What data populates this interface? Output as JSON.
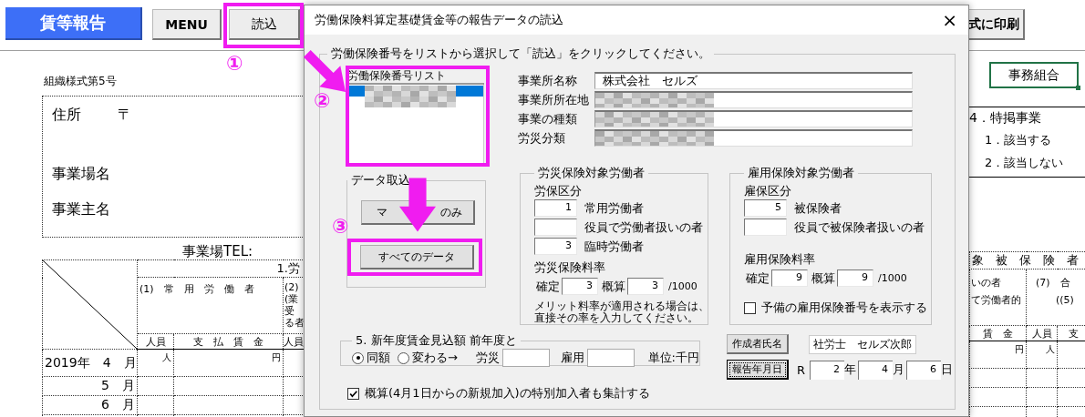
{
  "toolbar": {
    "title_button": {
      "label": "賃等報告"
    },
    "buttons": [
      {
        "label": "MENU"
      },
      {
        "label": "読込"
      }
    ],
    "print_button": {
      "label": "式に印刷"
    }
  },
  "sheet_left": {
    "form_number": "組織様式第5号",
    "address_label": "住所",
    "postal_mark": "〒",
    "site_label": "事業場名",
    "owner_label": "事業主名",
    "tel_label": "事業場TEL:",
    "table": {
      "section": "1.労",
      "col1_heading": "(1)　常　用　労　働　者",
      "col2_lines": [
        "(2)",
        "(業",
        "受",
        "る者"
      ],
      "subheads": [
        "人員",
        "支　払　賃　金",
        "人員"
      ],
      "units": [
        "人",
        "円"
      ],
      "rows": [
        "2019年　4　月",
        "5　月",
        "6　月"
      ]
    }
  },
  "sheet_right": {
    "selected_cell": "事務組合",
    "special_title": "4．特掲事業",
    "special_options": [
      "1．該当する",
      "2．該当しない"
    ],
    "table": {
      "header": "象　被　保　険　者",
      "col1_lines": [
        "いの者",
        "て労働者的"
      ],
      "col2_lines": [
        "(7)　合",
        "((5)"
      ],
      "subheads": [
        "賃　金",
        "人員",
        "支"
      ],
      "units": [
        "円",
        "人"
      ]
    }
  },
  "dialog": {
    "title": "労働保険料算定基礎賃金等の報告データの読込",
    "close": "×",
    "legend": "労働保険番号をリストから選択して「読込」をクリックしてください。",
    "list": {
      "header": "労働保険番号リスト",
      "items": [
        {
          "blurred": true,
          "selected": true
        },
        {
          "blurred": true,
          "selected": false
        }
      ]
    },
    "info": [
      {
        "label": "事業所名称",
        "value": "株式会社　セルズ"
      },
      {
        "label": "事業所所在地",
        "blurred": true
      },
      {
        "label": "事業の種類",
        "blurred": true
      },
      {
        "label": "労災分類",
        "blurred": true
      }
    ],
    "import": {
      "legend": "データ取込",
      "master_button": [
        "マ",
        "のみ"
      ],
      "all_button": "すべてのデータ"
    },
    "rousai": {
      "legend": "労災保険対象労働者",
      "class_label": "労保区分",
      "rows": [
        {
          "value": "1",
          "label": "常用労働者"
        },
        {
          "label": "役員で労働者扱いの者"
        },
        {
          "value": "3",
          "label": "臨時労働者"
        }
      ],
      "rate_label": "労災保険料率",
      "fixed_label": "確定",
      "fixed": "3",
      "est_label": "概算",
      "est": "3",
      "per": "/1000",
      "note": "メリット料率が適用される場合は、直接その率を入力してください。"
    },
    "koyou": {
      "legend": "雇用保険対象労働者",
      "class_label": "雇保区分",
      "rows": [
        {
          "value": "5",
          "label": "被保険者"
        },
        {
          "label": "役員で被保険者扱いの者"
        }
      ],
      "rate_label": "雇用保険料率",
      "fixed_label": "確定",
      "fixed": "9",
      "est_label": "概算",
      "est": "9",
      "per": "/1000",
      "spare_checkbox": {
        "label": "予備の雇用保険番号を表示する",
        "checked": false
      }
    },
    "estimate": {
      "legend": "5. 新年度賃金見込額  前年度と",
      "options": [
        {
          "label": "同額",
          "selected": true
        },
        {
          "label": "変わる→",
          "selected": false
        }
      ],
      "rousai_label": "労災",
      "koyou_label": "雇用",
      "unit": "単位:千円"
    },
    "author": {
      "button": "作成者氏名",
      "value": "社労士　セルズ次郎"
    },
    "date": {
      "button": "報告年月日",
      "era": "R",
      "year": "2",
      "year_unit": "年",
      "month": "4",
      "month_unit": "月",
      "day": "6",
      "day_unit": "日"
    },
    "special_checkbox": {
      "label": "概算(4月1日からの新規加入)の特別加入者も集計する",
      "checked": true
    }
  },
  "annotations": {
    "steps": [
      {
        "label": "①"
      },
      {
        "label": "②"
      },
      {
        "label": "③"
      }
    ]
  }
}
